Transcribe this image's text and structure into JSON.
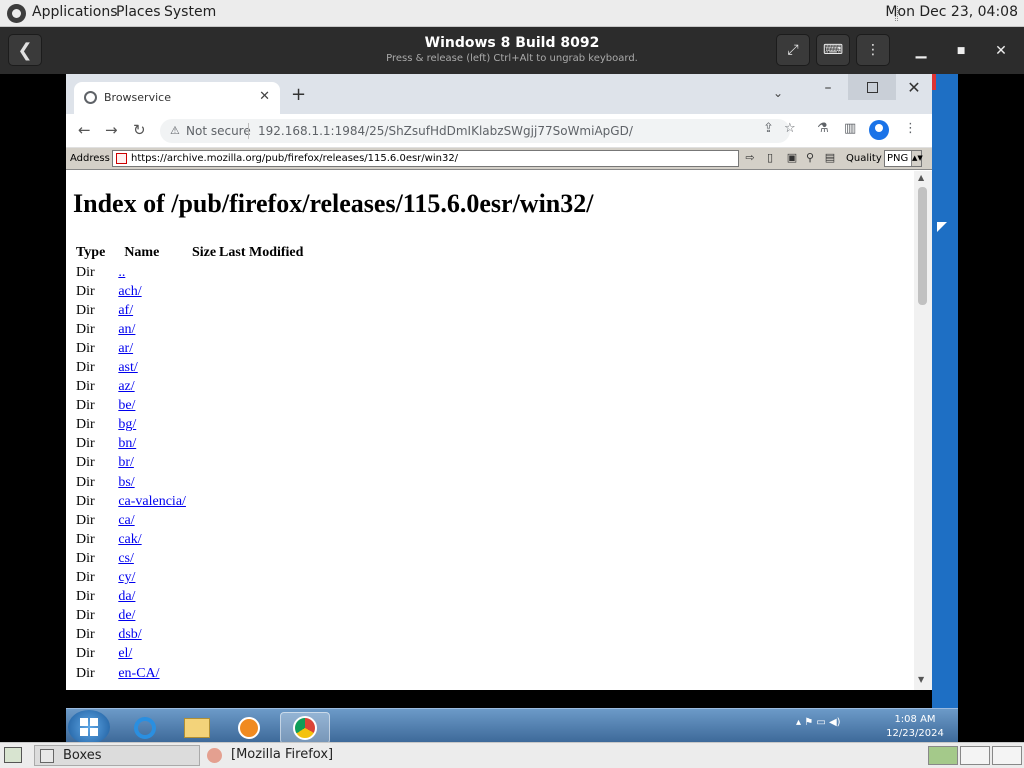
{
  "top_panel": {
    "menus": [
      "Applications",
      "Places",
      "System"
    ],
    "clock": "Mon Dec 23, 04:08"
  },
  "boxes": {
    "title": "Windows 8 Build 8092",
    "subtitle": "Press & release (left) Ctrl+Alt to ungrab keyboard."
  },
  "chrome": {
    "tab_title": "Browservice",
    "security_label": "Not secure",
    "url": "192.168.1.1:1984/25/ShZsufHdDmIKlabzSWgjj77SoWmiApGD/"
  },
  "browservice": {
    "address_label": "Address",
    "address_value": "https://archive.mozilla.org/pub/firefox/releases/115.6.0esr/win32/",
    "quality_label": "Quality",
    "quality_value": "PNG"
  },
  "page": {
    "heading": "Index of /pub/firefox/releases/115.6.0esr/win32/",
    "columns": [
      "Type",
      "Name",
      "Size",
      "Last Modified"
    ],
    "rows": [
      {
        "type": "Dir",
        "name": ".."
      },
      {
        "type": "Dir",
        "name": "ach/"
      },
      {
        "type": "Dir",
        "name": "af/"
      },
      {
        "type": "Dir",
        "name": "an/"
      },
      {
        "type": "Dir",
        "name": "ar/"
      },
      {
        "type": "Dir",
        "name": "ast/"
      },
      {
        "type": "Dir",
        "name": "az/"
      },
      {
        "type": "Dir",
        "name": "be/"
      },
      {
        "type": "Dir",
        "name": "bg/"
      },
      {
        "type": "Dir",
        "name": "bn/"
      },
      {
        "type": "Dir",
        "name": "br/"
      },
      {
        "type": "Dir",
        "name": "bs/"
      },
      {
        "type": "Dir",
        "name": "ca-valencia/"
      },
      {
        "type": "Dir",
        "name": "ca/"
      },
      {
        "type": "Dir",
        "name": "cak/"
      },
      {
        "type": "Dir",
        "name": "cs/"
      },
      {
        "type": "Dir",
        "name": "cy/"
      },
      {
        "type": "Dir",
        "name": "da/"
      },
      {
        "type": "Dir",
        "name": "de/"
      },
      {
        "type": "Dir",
        "name": "dsb/"
      },
      {
        "type": "Dir",
        "name": "el/"
      },
      {
        "type": "Dir",
        "name": "en-CA/"
      }
    ]
  },
  "win_taskbar": {
    "time": "1:08 AM",
    "date": "12/23/2024"
  },
  "bottom_panel": {
    "tasks": [
      "Boxes",
      "[Mozilla Firefox]"
    ]
  }
}
